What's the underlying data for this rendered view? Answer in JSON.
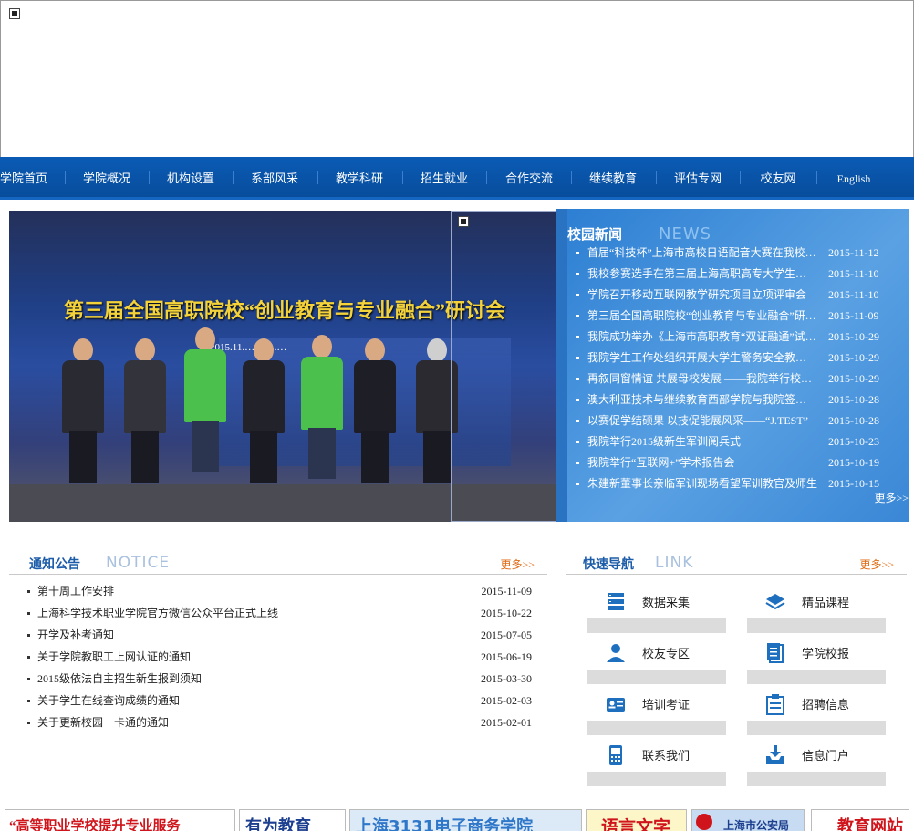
{
  "nav": {
    "items": [
      "学院首页",
      "学院概况",
      "机构设置",
      "系部风采",
      "教学科研",
      "招生就业",
      "合作交流",
      "继续教育",
      "评估专网",
      "校友网",
      "English"
    ]
  },
  "slide": {
    "title": "第三届全国高职院校“创业教育与专业融合”研讨会",
    "date_text": "2015.11.……11.…"
  },
  "news": {
    "title": "校园新闻",
    "title_en": "NEWS",
    "more": "更多>>",
    "items": [
      {
        "text": "首届“科技杯”上海市高校日语配音大赛在我校举行",
        "date": "2015-11-12"
      },
      {
        "text": "我校参赛选手在第三届上海高职高专大学生创业大赛中获佳绩",
        "date": "2015-11-10"
      },
      {
        "text": "学院召开移动互联网教学研究项目立项评审会",
        "date": "2015-11-10"
      },
      {
        "text": "第三届全国高职院校“创业教育与专业融合”研讨会",
        "date": "2015-11-09"
      },
      {
        "text": "我院成功举办《上海市高职教育“双证融通”试点工作》",
        "date": "2015-10-29"
      },
      {
        "text": "我院学生工作处组织开展大学生警务安全教育讲座",
        "date": "2015-10-29"
      },
      {
        "text": "再叙同窗情谊 共展母校发展 ——我院举行校友座谈会",
        "date": "2015-10-29"
      },
      {
        "text": "澳大利亚技术与继续教育西部学院与我院签署合作协议",
        "date": "2015-10-28"
      },
      {
        "text": "以赛促学结硕果 以技促能展风采——“J.TEST”",
        "date": "2015-10-28"
      },
      {
        "text": "我院举行2015级新生军训阅兵式",
        "date": "2015-10-23"
      },
      {
        "text": "我院举行“互联网+”学术报告会",
        "date": "2015-10-19"
      },
      {
        "text": "朱建新董事长亲临军训现场看望军训教官及师生",
        "date": "2015-10-15"
      }
    ]
  },
  "notice": {
    "title": "通知公告",
    "title_en": "NOTICE",
    "more": "更多>>",
    "items": [
      {
        "text": "第十周工作安排",
        "date": "2015-11-09"
      },
      {
        "text": "上海科学技术职业学院官方微信公众平台正式上线",
        "date": "2015-10-22"
      },
      {
        "text": "开学及补考通知",
        "date": "2015-07-05"
      },
      {
        "text": "关于学院教职工上网认证的通知",
        "date": "2015-06-19"
      },
      {
        "text": "2015级依法自主招生新生报到须知",
        "date": "2015-03-30"
      },
      {
        "text": "关于学生在线查询成绩的通知",
        "date": "2015-02-03"
      },
      {
        "text": "关于更新校园一卡通的通知",
        "date": "2015-02-01"
      }
    ]
  },
  "quicknav": {
    "title": "快速导航",
    "title_en": "LINK",
    "more": "更多>>",
    "items": [
      {
        "label": "数据采集",
        "icon": "database-icon"
      },
      {
        "label": "精品课程",
        "icon": "layers-icon"
      },
      {
        "label": "校友专区",
        "icon": "person-icon"
      },
      {
        "label": "学院校报",
        "icon": "document-icon"
      },
      {
        "label": "培训考证",
        "icon": "id-card-icon"
      },
      {
        "label": "招聘信息",
        "icon": "clipboard-icon"
      },
      {
        "label": "联系我们",
        "icon": "phone-icon"
      },
      {
        "label": "信息门户",
        "icon": "inbox-download-icon"
      }
    ]
  },
  "links": {
    "items": [
      "“高等职业学校提升专业服务",
      "有为教育",
      "上海3131电子商务学院",
      "语言文字",
      "上海市公安局",
      "教育网站"
    ]
  },
  "colors": {
    "nav_bg": "#0a5bb5",
    "news_bg": "#3a87d6",
    "accent_title": "#1c5ca9",
    "more_orange": "#e06b14"
  }
}
